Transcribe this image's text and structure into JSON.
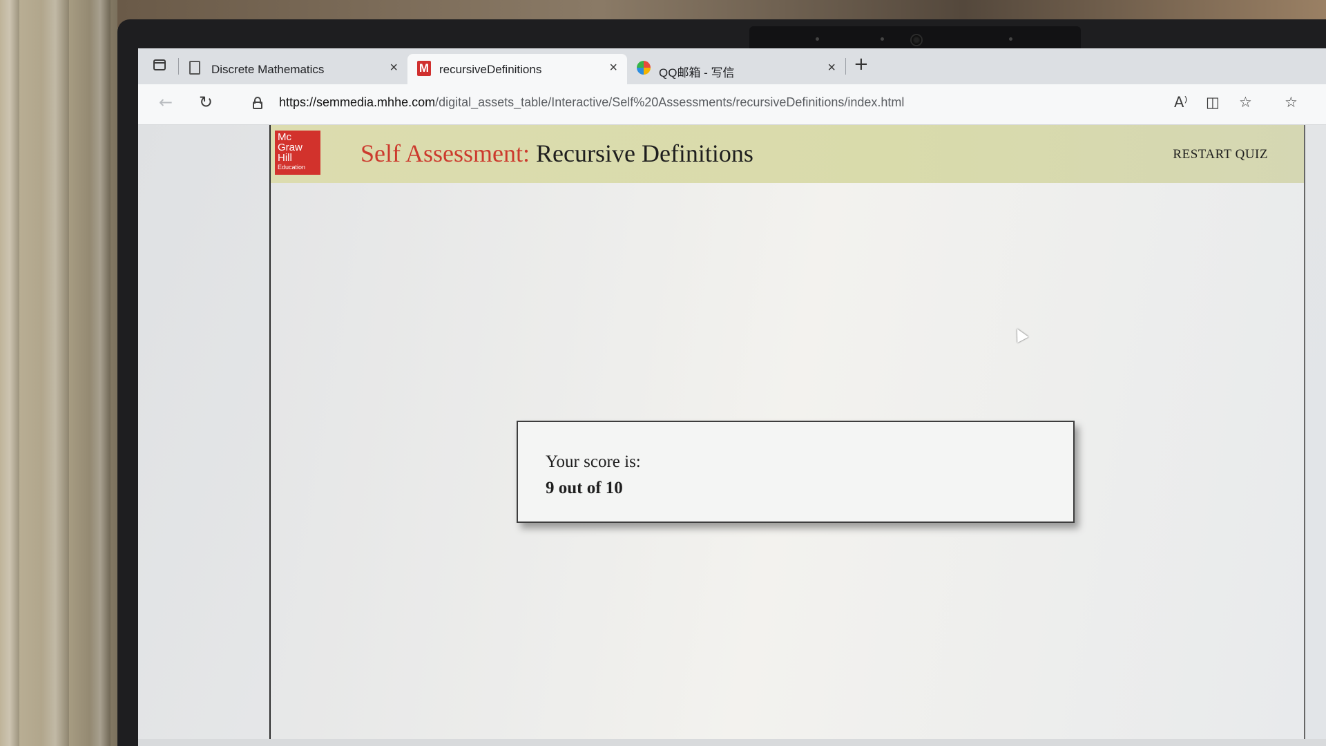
{
  "browser": {
    "tabs": [
      {
        "label": "Discrete Mathematics",
        "icon": "page-icon",
        "active": false
      },
      {
        "label": "recursiveDefinitions",
        "icon": "mcgraw-hill-m-icon",
        "icon_text": "M",
        "active": true
      },
      {
        "label": "QQ邮箱 - 写信",
        "icon": "qq-mail-icon",
        "active": false
      }
    ],
    "new_tab_symbol": "+",
    "close_symbol": "×",
    "url_host": "https://semmedia.mhhe.com",
    "url_path": "/digital_assets_table/Interactive/Self%20Assessments/recursiveDefinitions/index.html",
    "toolbar_icons": [
      "read-aloud-icon",
      "split-screen-icon",
      "add-favorite-icon",
      "favorites-icon"
    ]
  },
  "page": {
    "logo": {
      "line1": "Mc",
      "line2": "Graw",
      "line3": "Hill",
      "line4": "Education",
      "color": "#d2322c"
    },
    "title_prefix": "Self Assessment:",
    "title_suffix": "Recursive Definitions",
    "restart_label": "RESTART QUIZ",
    "score_label": "Your score is:",
    "score_value": "9 out of 10"
  },
  "colors": {
    "header_bg": "#dcdcaf",
    "title_accent": "#cc3a2d",
    "text": "#1e1e1e"
  }
}
